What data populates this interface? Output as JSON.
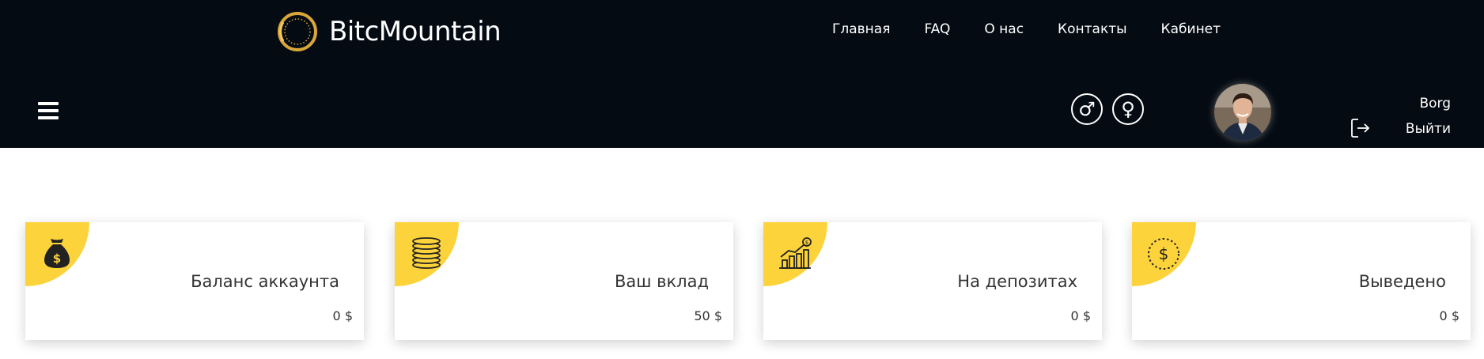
{
  "brand": {
    "name": "BitcMountain",
    "icon": "coin-logo-icon",
    "accent": "#fdd33c"
  },
  "nav": {
    "items": [
      {
        "label": "Главная"
      },
      {
        "label": "FAQ"
      },
      {
        "label": "О нас"
      },
      {
        "label": "Контакты"
      },
      {
        "label": "Кабинет"
      }
    ]
  },
  "toolbar": {
    "menu_icon": "hamburger-menu-icon",
    "male_symbol": "♂",
    "female_symbol": "♀"
  },
  "user": {
    "name": "Borg",
    "logout_label": "Выйти",
    "avatar": "user-avatar"
  },
  "cards": [
    {
      "title": "Баланс аккаунта",
      "value": "0 $",
      "icon": "money-bag-icon"
    },
    {
      "title": "Ваш вклад",
      "value": "50 $",
      "icon": "coin-stack-icon"
    },
    {
      "title": "На депозитах",
      "value": "0 $",
      "icon": "growth-chart-icon"
    },
    {
      "title": "Выведено",
      "value": "0 $",
      "icon": "dollar-circle-icon"
    }
  ],
  "colors": {
    "header_bg": "#050b12",
    "card_accent": "#fdd33c",
    "text": "#333333"
  }
}
